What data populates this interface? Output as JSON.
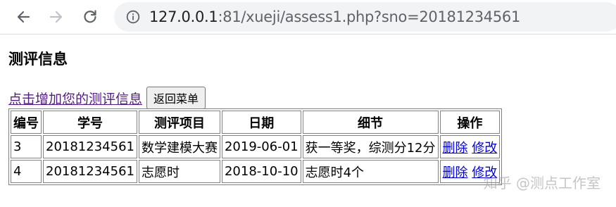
{
  "browser": {
    "url_host": "127.0.0.1",
    "url_rest": ":81/xueji/assess1.php?sno=20181234561"
  },
  "page": {
    "title": "测评信息",
    "add_link": "点击增加您的测评信息",
    "back_button": "返回菜单"
  },
  "table": {
    "headers": [
      "编号",
      "学号",
      "测评项目",
      "日期",
      "细节",
      "操作"
    ],
    "rows": [
      {
        "id": "3",
        "sno": "20181234561",
        "item": "数学建模大赛",
        "date": "2019-06-01",
        "detail": "获一等奖，综测分12分",
        "delete": "删除",
        "edit": "修改"
      },
      {
        "id": "4",
        "sno": "20181234561",
        "item": "志愿时",
        "date": "2018-10-10",
        "detail": "志愿时4个",
        "delete": "删除",
        "edit": "修改"
      }
    ]
  },
  "watermark": "知乎 @测点工作室"
}
